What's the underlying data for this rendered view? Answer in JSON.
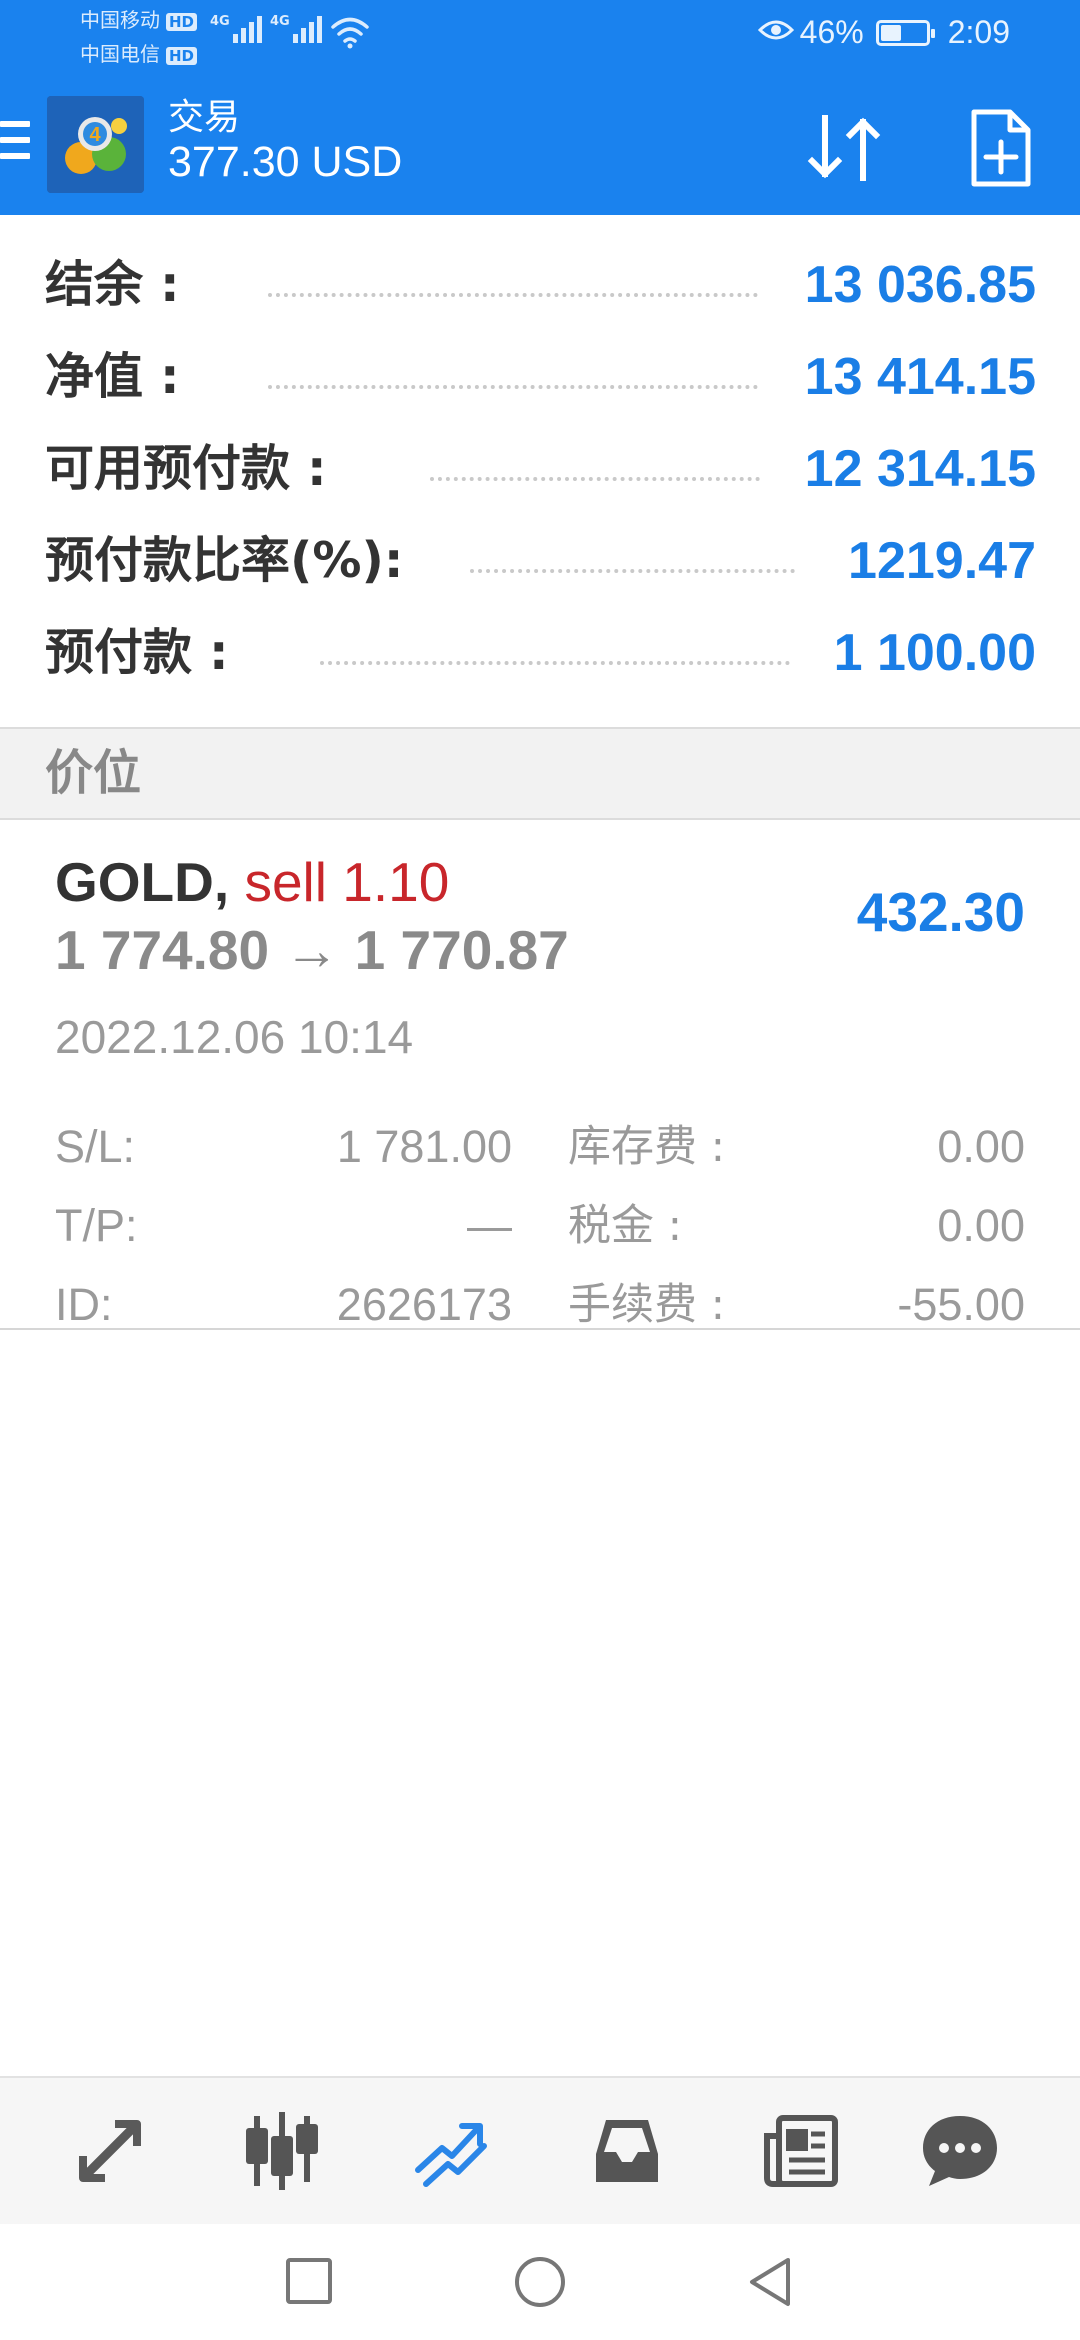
{
  "status_bar": {
    "carrier1": "中国移动",
    "carrier2": "中国电信",
    "hd": "HD",
    "net1": "4G",
    "net2": "4G",
    "battery_percent": "46%",
    "battery_level": 0.46,
    "time": "2:09"
  },
  "app_bar": {
    "title": "交易",
    "subtitle": "377.30 USD",
    "icons": {
      "menu": "menu-icon",
      "logo": "metatrader-logo",
      "sort": "sort-arrows-icon",
      "new_order": "new-document-plus-icon"
    }
  },
  "summary": [
    {
      "label": "结余 :",
      "value": "13 036.85"
    },
    {
      "label": "净值 :",
      "value": "13 414.15"
    },
    {
      "label": "可用预付款 :",
      "value": "12 314.15"
    },
    {
      "label": "预付款比率(%):",
      "value": "1219.47"
    },
    {
      "label": "预付款 :",
      "value": "1 100.00"
    }
  ],
  "section_title": "价位",
  "position": {
    "symbol": "GOLD,",
    "side_volume": "sell 1.10",
    "prices": "1 774.80 → 1 770.87",
    "profit": "432.30",
    "time": "2022.12.06 10:14",
    "details": {
      "sl_label": "S/L:",
      "sl_value": "1 781.00",
      "tp_label": "T/P:",
      "tp_value": "—",
      "id_label": "ID:",
      "id_value": "2626173",
      "swap_label": "库存费 :",
      "swap_value": "0.00",
      "tax_label": "税金 :",
      "tax_value": "0.00",
      "commission_label": "手续费 :",
      "commission_value": "-55.00"
    }
  },
  "bottom_nav": [
    "quotes-icon",
    "chart-candles-icon",
    "trade-icon",
    "history-inbox-icon",
    "news-icon",
    "chat-icon"
  ],
  "colors": {
    "brand": "#1a82ee",
    "value": "#1a7ee6",
    "sell": "#c8262b",
    "active_tab": "#2a86e8"
  }
}
